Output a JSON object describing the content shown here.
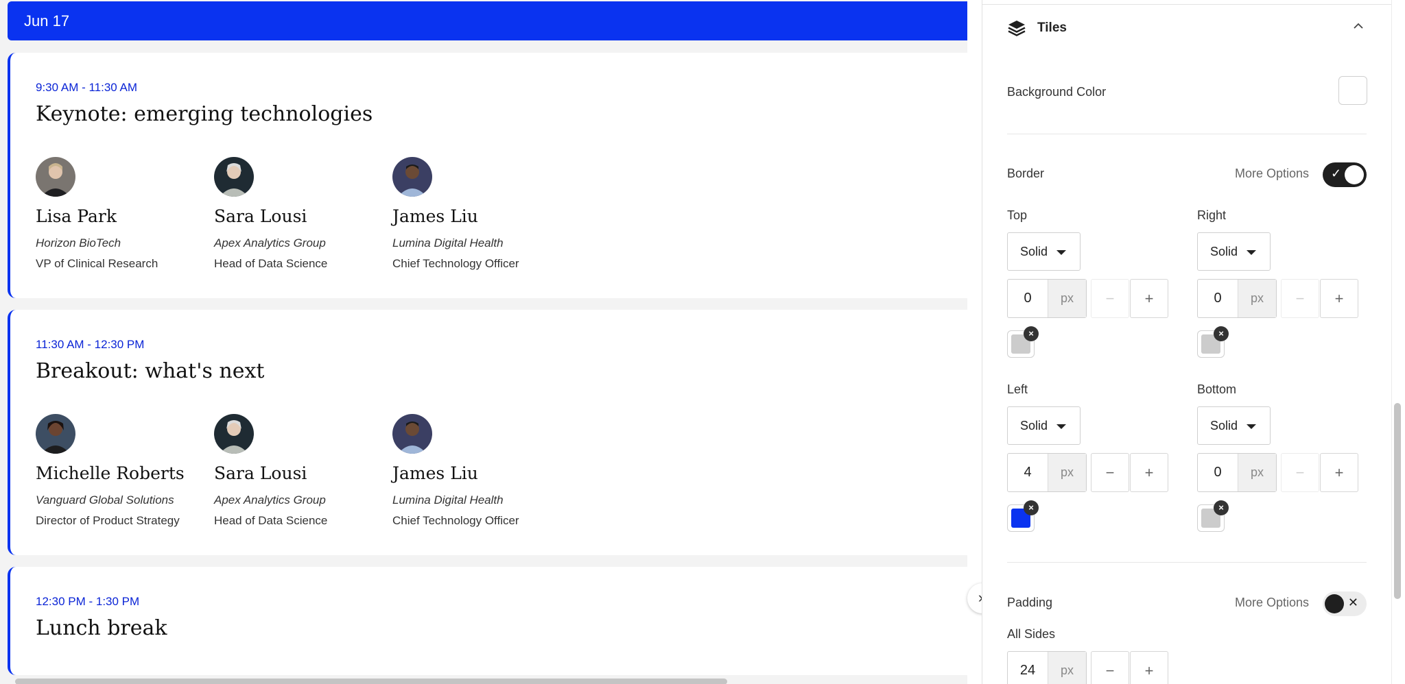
{
  "preview": {
    "date": "Jun 17",
    "accent_color": "#0a33f0",
    "sessions": [
      {
        "time": "9:30 AM - 11:30 AM",
        "title": "Keynote: emerging technologies",
        "speakers": [
          {
            "name": "Lisa Park",
            "org": "Horizon BioTech",
            "role": "VP of Clinical Research"
          },
          {
            "name": "Sara Lousi",
            "org": "Apex Analytics Group",
            "role": "Head of Data Science"
          },
          {
            "name": "James Liu",
            "org": "Lumina Digital Health",
            "role": "Chief Technology Officer"
          }
        ]
      },
      {
        "time": "11:30 AM - 12:30 PM",
        "title": "Breakout: what's next",
        "speakers": [
          {
            "name": "Michelle Roberts",
            "org": "Vanguard Global Solutions",
            "role": "Director of Product Strategy"
          },
          {
            "name": "Sara Lousi",
            "org": "Apex Analytics Group",
            "role": "Head of Data Science"
          },
          {
            "name": "James Liu",
            "org": "Lumina Digital Health",
            "role": "Chief Technology Officer"
          }
        ]
      },
      {
        "time": "12:30 PM - 1:30 PM",
        "title": "Lunch break",
        "speakers": []
      }
    ]
  },
  "panel": {
    "section_title": "Tiles",
    "section_icon": "layers-icon",
    "background_color_label": "Background Color",
    "border": {
      "label": "Border",
      "more_options_label": "More Options",
      "more_options_on": true,
      "sides": {
        "top": {
          "label": "Top",
          "style": "Solid",
          "width": "0",
          "unit": "px",
          "color": "#cccccc"
        },
        "right": {
          "label": "Right",
          "style": "Solid",
          "width": "0",
          "unit": "px",
          "color": "#cccccc"
        },
        "left": {
          "label": "Left",
          "style": "Solid",
          "width": "4",
          "unit": "px",
          "color": "#0a33f0"
        },
        "bottom": {
          "label": "Bottom",
          "style": "Solid",
          "width": "0",
          "unit": "px",
          "color": "#cccccc"
        }
      }
    },
    "padding": {
      "label": "Padding",
      "more_options_label": "More Options",
      "more_options_on": false,
      "all_sides_label": "All Sides",
      "value": "24",
      "unit": "px"
    },
    "stepper": {
      "minus": "−",
      "plus": "+"
    },
    "clear_glyph": "×"
  }
}
